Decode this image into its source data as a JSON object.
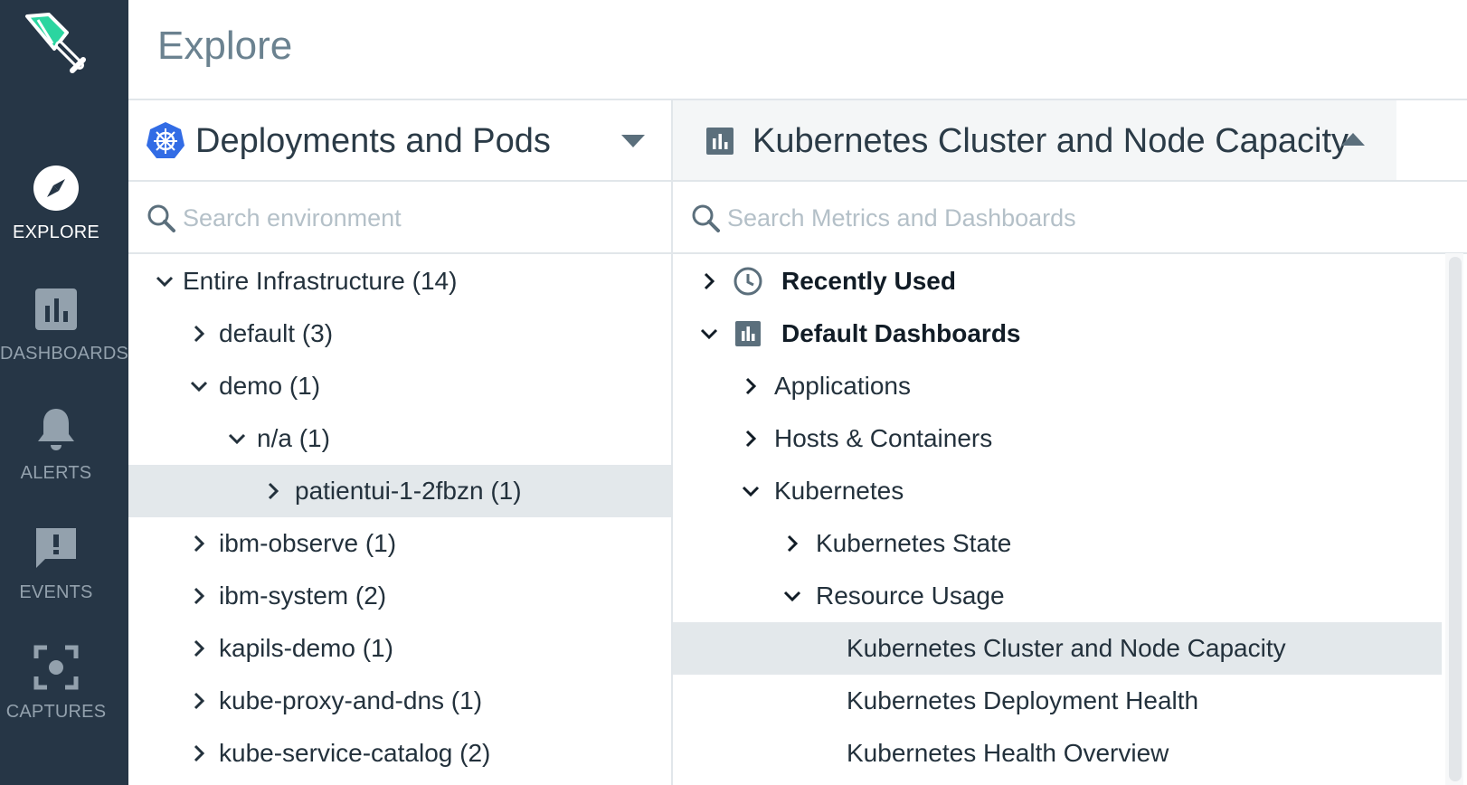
{
  "sidebar": {
    "items": [
      {
        "label": "EXPLORE",
        "icon": "compass-icon"
      },
      {
        "label": "DASHBOARDS",
        "icon": "bar-chart-icon"
      },
      {
        "label": "ALERTS",
        "icon": "bell-icon"
      },
      {
        "label": "EVENTS",
        "icon": "exclamation-chat-icon"
      },
      {
        "label": "CAPTURES",
        "icon": "capture-icon"
      }
    ]
  },
  "header": {
    "title": "Explore"
  },
  "left_panel": {
    "title": "Deployments and Pods",
    "search_placeholder": "Search environment",
    "tree": [
      {
        "label": "Entire Infrastructure (14)",
        "expanded": true
      },
      {
        "label": "default (3)",
        "expanded": false
      },
      {
        "label": "demo (1)",
        "expanded": true
      },
      {
        "label": "n/a (1)",
        "expanded": true
      },
      {
        "label": "patientui-1-2fbzn (1)",
        "expanded": false,
        "selected": true
      },
      {
        "label": "ibm-observe (1)",
        "expanded": false
      },
      {
        "label": "ibm-system (2)",
        "expanded": false
      },
      {
        "label": "kapils-demo (1)",
        "expanded": false
      },
      {
        "label": "kube-proxy-and-dns (1)",
        "expanded": false
      },
      {
        "label": "kube-service-catalog (2)",
        "expanded": false
      }
    ]
  },
  "right_panel": {
    "title": "Kubernetes Cluster and Node Capacity",
    "search_placeholder": "Search Metrics and Dashboards",
    "tree": [
      {
        "label": "Recently Used",
        "expanded": false
      },
      {
        "label": "Default Dashboards",
        "expanded": true
      },
      {
        "label": "Applications",
        "expanded": false
      },
      {
        "label": "Hosts & Containers",
        "expanded": false
      },
      {
        "label": "Kubernetes",
        "expanded": true
      },
      {
        "label": "Kubernetes State",
        "expanded": false
      },
      {
        "label": "Resource Usage",
        "expanded": true
      },
      {
        "label": "Kubernetes Cluster and Node Capacity",
        "selected": true
      },
      {
        "label": "Kubernetes Deployment Health"
      },
      {
        "label": "Kubernetes Health Overview"
      }
    ]
  },
  "colors": {
    "sidebar_bg": "#263646",
    "accent_green": "#2bd5a0",
    "kubernetes_blue": "#326ce5",
    "selected_row": "#e3e8eb"
  }
}
